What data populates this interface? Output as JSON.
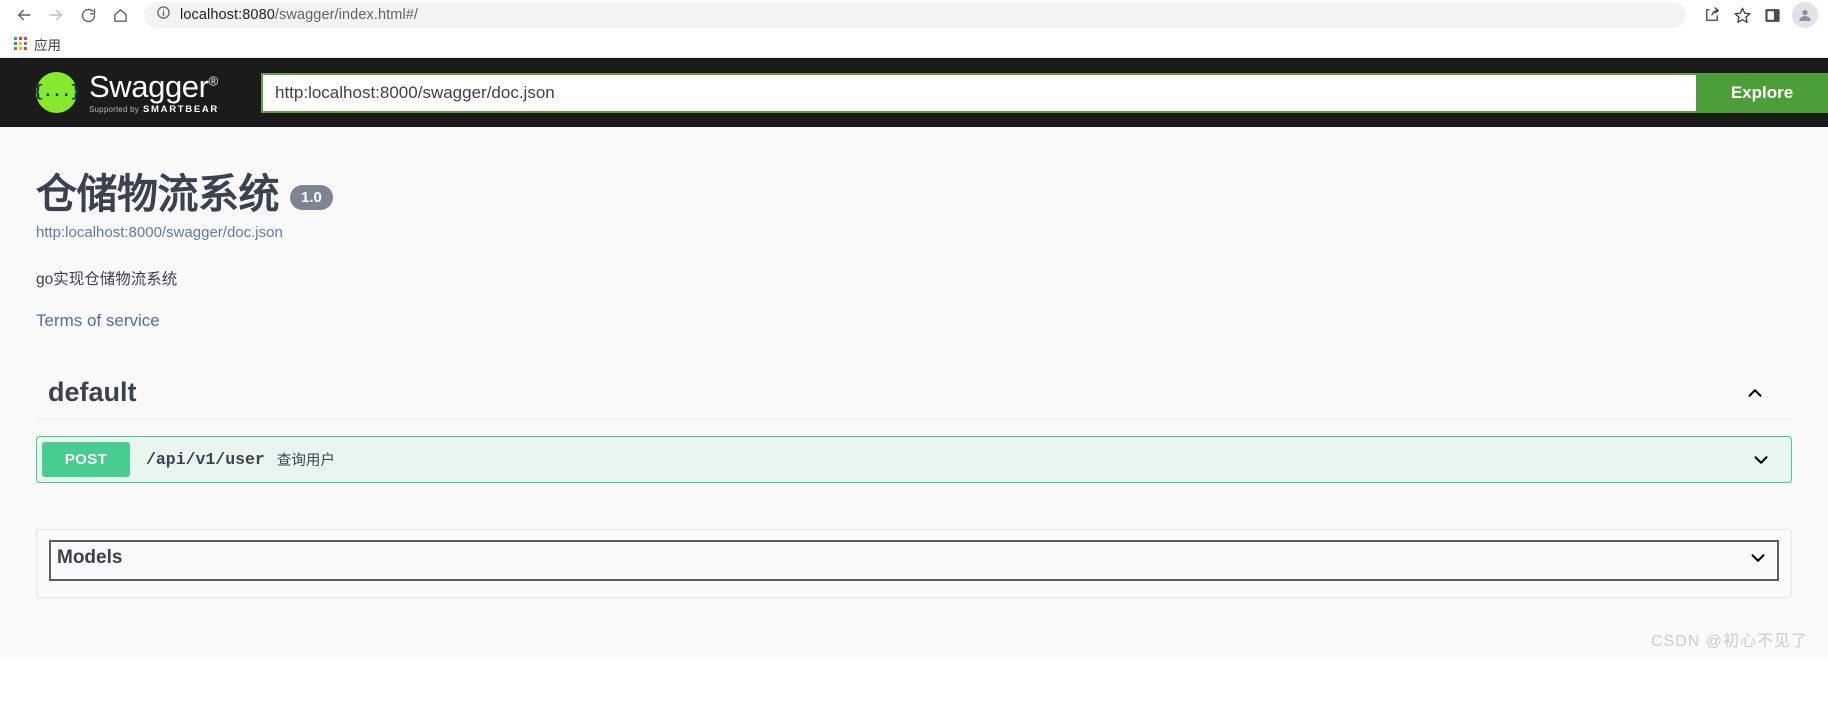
{
  "browser": {
    "back_label": "Back",
    "forward_label": "Forward",
    "reload_label": "Reload",
    "home_label": "Home",
    "site_info_label": "site-info",
    "address": {
      "host": "localhost:8080",
      "path": "/swagger/index.html#/",
      "full": "localhost:8080/swagger/index.html#/"
    },
    "actions": {
      "share_label": "Share",
      "bookmark_label": "Bookmark this tab",
      "sidebar_label": "Side panel",
      "profile_label": "Profile"
    },
    "bookmarks": [
      {
        "label": "应用",
        "icon": "apps-grid-icon"
      }
    ]
  },
  "swagger_topbar": {
    "logo_word": "Swagger",
    "logo_mark": "{...}",
    "logo_trademark": "®",
    "supported_by": "Supported by",
    "brand": "SMARTBEAR",
    "explore_url": "http:localhost:8000/swagger/doc.json",
    "explore_placeholder": "http:localhost:8000/swagger/doc.json",
    "explore_button": "Explore"
  },
  "info": {
    "title": "仓储物流系统",
    "version": "1.0",
    "doc_url": "http:localhost:8000/swagger/doc.json",
    "description": "go实现仓储物流系统",
    "terms_of_service": "Terms of service"
  },
  "tags": [
    {
      "name": "default",
      "expanded": true,
      "chevron": "chevron-up-icon",
      "operations": [
        {
          "method": "POST",
          "path": "/api/v1/user",
          "summary": "查询用户",
          "expanded": false,
          "chevron": "chevron-down-icon"
        }
      ]
    }
  ],
  "models": {
    "title": "Models",
    "expanded": false,
    "chevron": "chevron-down-icon"
  },
  "watermark": "CSDN @初心不见了",
  "colors": {
    "topbar_bg": "#1b1b1b",
    "logo_green": "#85ea2d",
    "explore_green": "#4c9f38",
    "post_green": "#49cc90",
    "post_row_bg": "#e8f6f0",
    "text_dark": "#3b4151",
    "link_blue": "#4d6fa3",
    "badge_gray": "#7d8492",
    "page_bg": "#fafafa"
  }
}
